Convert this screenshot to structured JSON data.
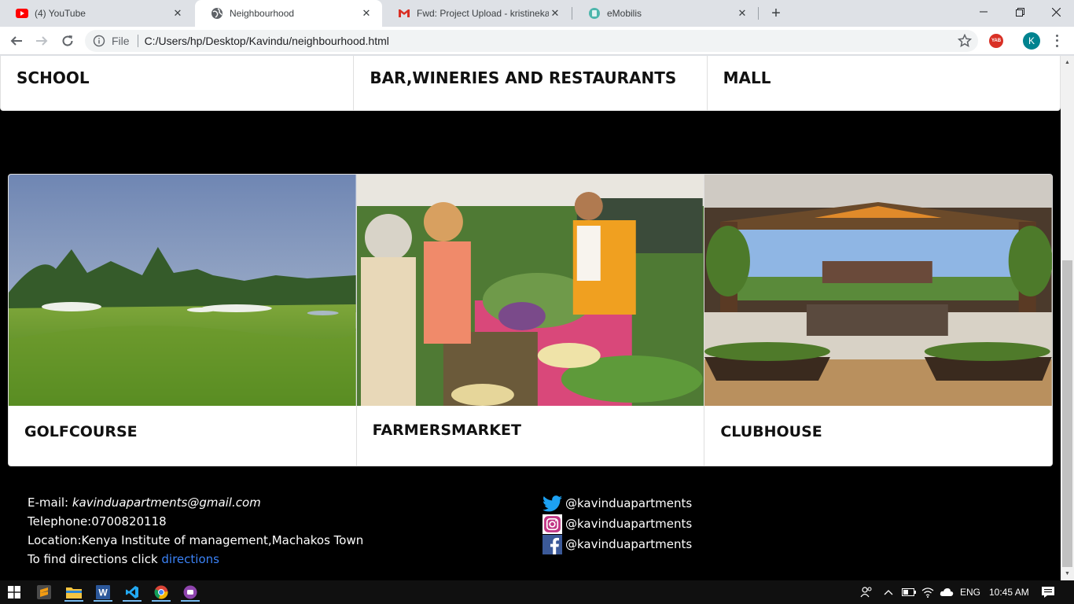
{
  "browser": {
    "tabs": [
      {
        "label": "(4) YouTube",
        "icon": "youtube-icon",
        "active": false
      },
      {
        "label": "Neighbourhood",
        "icon": "globe-icon",
        "active": true
      },
      {
        "label": "Fwd: Project Upload - kristinekak",
        "icon": "gmail-icon",
        "active": false
      },
      {
        "label": "eMobilis",
        "icon": "emobilis-icon",
        "active": false
      }
    ],
    "address": {
      "scheme_label": "File",
      "url": "C:/Users/hp/Desktop/Kavindu/neighbourhood.html"
    },
    "extension_label": "YAB",
    "profile_initial": "K"
  },
  "page": {
    "top_cards": [
      "SCHOOL",
      "BAR,WINERIES AND RESTAURANTS",
      "MALL"
    ],
    "cards": [
      {
        "title": "GOLFCOURSE",
        "image": "golf-course-photo"
      },
      {
        "title": "FARMERSMARKET",
        "image": "farmers-market-photo"
      },
      {
        "title": "CLUBHOUSE",
        "image": "clubhouse-photo"
      }
    ],
    "contact": {
      "email_label": "E-mail: ",
      "email": "kavinduapartments@gmail.com",
      "telephone": "Telephone:0700820118",
      "location": "Location:Kenya Institute of management,Machakos Town",
      "directions_prefix": "To find directions click ",
      "directions_link": "directions"
    },
    "social": [
      {
        "icon": "twitter-icon",
        "handle": "@kavinduapartments"
      },
      {
        "icon": "instagram-icon",
        "handle": "@kavinduapartments"
      },
      {
        "icon": "facebook-icon",
        "handle": "@kavinduapartments"
      }
    ]
  },
  "taskbar": {
    "language": "ENG",
    "time": "10:45 AM"
  },
  "colors": {
    "page_bg": "#000000",
    "link": "#3b82f6",
    "chrome_bg": "#dee1e6"
  }
}
